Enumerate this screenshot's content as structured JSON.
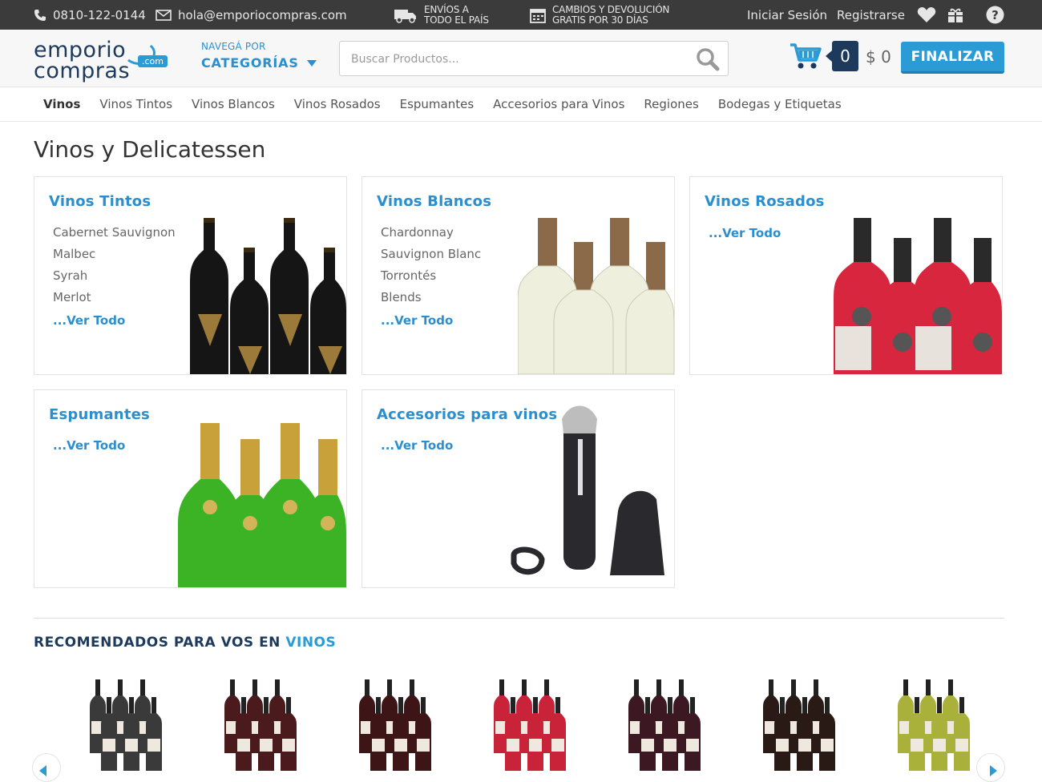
{
  "topbar": {
    "phone": "0810-122-0144",
    "email": "hola@emporiocompras.com",
    "shipping_line1": "ENVÍOS A",
    "shipping_line2": "TODO EL PAÍS",
    "returns_line1": "CAMBIOS Y DEVOLUCIÓN",
    "returns_line2": "GRATIS POR 30 DÍAS",
    "login": "Iniciar Sesión",
    "register": "Registrarse"
  },
  "header": {
    "logo_line1": "emporio",
    "logo_line2": "compras",
    "logo_badge": ".com",
    "nav_pre": "NAVEGÁ POR",
    "nav_main": "CATEGORÍAS",
    "search_placeholder": "Buscar Productos...",
    "cart_count": "0",
    "cart_total": "$ 0",
    "checkout_label": "FINALIZAR"
  },
  "subnav": [
    "Vinos",
    "Vinos Tintos",
    "Vinos Blancos",
    "Vinos Rosados",
    "Espumantes",
    "Accesorios para Vinos",
    "Regiones",
    "Bodegas y Etiquetas"
  ],
  "page_title": "Vinos y Delicatessen",
  "categories": [
    {
      "title": "Vinos Tintos",
      "items": [
        "Cabernet Sauvignon",
        "Malbec",
        "Syrah",
        "Merlot"
      ],
      "more": "...Ver Todo",
      "image": "red-wine-bottles"
    },
    {
      "title": "Vinos Blancos",
      "items": [
        "Chardonnay",
        "Sauvignon Blanc",
        "Torrontés",
        "Blends"
      ],
      "more": "...Ver Todo",
      "image": "white-wine-bottles"
    },
    {
      "title": "Vinos Rosados",
      "items": [],
      "more": "...Ver Todo",
      "image": "rose-wine-bottles"
    },
    {
      "title": "Espumantes",
      "items": [],
      "more": "...Ver Todo",
      "image": "sparkling-wine-bottles"
    },
    {
      "title": "Accesorios para vinos",
      "items": [],
      "more": "...Ver Todo",
      "image": "electric-corkscrew"
    }
  ],
  "recommended": {
    "title_prefix": "RECOMENDADOS PARA VOS EN",
    "title_highlight": "VINOS",
    "products": [
      {
        "image": "dark-wine-pack",
        "color": "#3a3a3a"
      },
      {
        "image": "red-wine-pack",
        "color": "#4a1a1c"
      },
      {
        "image": "red-wine-pack",
        "color": "#3d1517"
      },
      {
        "image": "rose-wine-pack",
        "color": "#c9233a"
      },
      {
        "image": "red-wine-pack",
        "color": "#3b1822"
      },
      {
        "image": "red-wine-pack",
        "color": "#2a1a16"
      },
      {
        "image": "white-wine-pack",
        "color": "#a9b13a"
      }
    ]
  },
  "colors": {
    "accent": "#2b9bd6",
    "navy": "#1d3a5c",
    "topbar": "#3b3b3b"
  }
}
